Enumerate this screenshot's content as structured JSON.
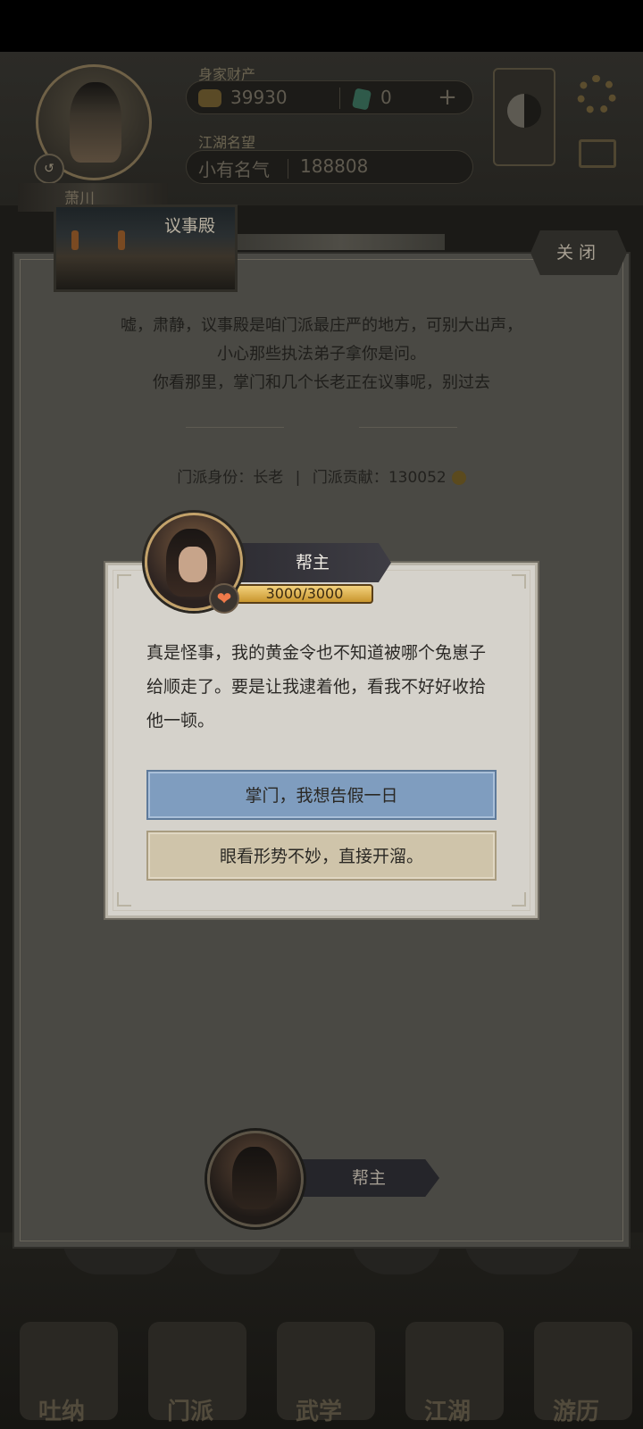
{
  "hud": {
    "player_name": "萧川",
    "level_badge": "↺",
    "assets_label": "身家财产",
    "gold": "39930",
    "jade": "0",
    "plus": "+",
    "fame_label": "江湖名望",
    "fame_title": "小有名气",
    "fame_value": "188808"
  },
  "panel": {
    "location_title": "议事殿",
    "close_label": "关闭",
    "intro_lines": [
      "嘘，肃静，议事殿是咱门派最庄严的地方，可别大出声，",
      "小心那些执法弟子拿你是问。",
      "你看那里，掌门和几个长老正在议事呢，别过去"
    ],
    "sect_identity_label": "门派身份：",
    "sect_identity": "长老",
    "separator": "|",
    "contribution_label": "门派贡献：",
    "contribution": "130052"
  },
  "dialog": {
    "npc_name": "帮主",
    "favor": "3000/3000",
    "heart": "❤",
    "text": "真是怪事，我的黄金令也不知道被哪个兔崽子给顺走了。要是让我逮着他，看我不好好收拾他一顿。",
    "choices": [
      "掌门，我想告假一日",
      "眼看形势不妙，直接开溜。"
    ]
  },
  "bottom_npc": {
    "name": "帮主"
  },
  "nav": {
    "tabs": [
      "吐纳",
      "门派",
      "武学",
      "江湖",
      "游历"
    ]
  },
  "colors": {
    "choice_primary": "#7f9dbf",
    "choice_secondary": "#cfc4aa",
    "favor_bar": "#e0b04a",
    "panel_overlay": "#4a4944"
  }
}
